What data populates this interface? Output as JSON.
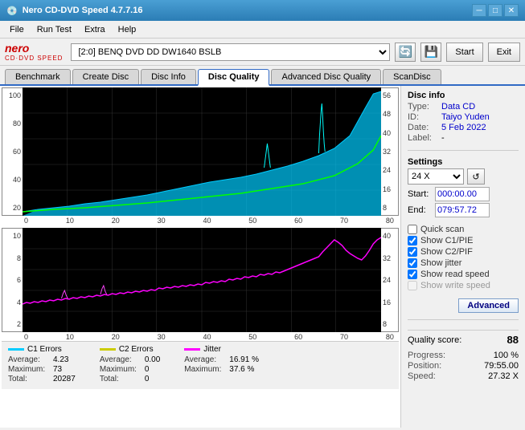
{
  "titleBar": {
    "title": "Nero CD-DVD Speed 4.7.7.16",
    "controls": [
      "minimize",
      "maximize",
      "close"
    ]
  },
  "menuBar": {
    "items": [
      "File",
      "Run Test",
      "Extra",
      "Help"
    ]
  },
  "toolbar": {
    "logoTop": "nero",
    "logoBottom": "CD·DVD SPEED",
    "driveLabel": "[2:0]  BENQ DVD DD DW1640 BSLB",
    "startLabel": "Start",
    "exitLabel": "Exit"
  },
  "tabs": [
    {
      "label": "Benchmark",
      "active": false
    },
    {
      "label": "Create Disc",
      "active": false
    },
    {
      "label": "Disc Info",
      "active": false
    },
    {
      "label": "Disc Quality",
      "active": true
    },
    {
      "label": "Advanced Disc Quality",
      "active": false
    },
    {
      "label": "ScanDisc",
      "active": false
    }
  ],
  "discInfo": {
    "sectionTitle": "Disc info",
    "typeLabel": "Type:",
    "typeValue": "Data CD",
    "idLabel": "ID:",
    "idValue": "Taiyo Yuden",
    "dateLabel": "Date:",
    "dateValue": "5 Feb 2022",
    "labelLabel": "Label:",
    "labelValue": "-"
  },
  "settings": {
    "sectionTitle": "Settings",
    "speedLabel": "24 X",
    "startLabel": "Start:",
    "startValue": "000:00.00",
    "endLabel": "End:",
    "endValue": "079:57.72"
  },
  "checkboxes": [
    {
      "label": "Quick scan",
      "checked": false,
      "enabled": true
    },
    {
      "label": "Show C1/PIE",
      "checked": true,
      "enabled": true
    },
    {
      "label": "Show C2/PIF",
      "checked": true,
      "enabled": true
    },
    {
      "label": "Show jitter",
      "checked": true,
      "enabled": true
    },
    {
      "label": "Show read speed",
      "checked": true,
      "enabled": true
    },
    {
      "label": "Show write speed",
      "checked": false,
      "enabled": false
    }
  ],
  "advancedButton": "Advanced",
  "qualityScore": {
    "label": "Quality score:",
    "value": "88"
  },
  "progress": {
    "progressLabel": "Progress:",
    "progressValue": "100 %",
    "positionLabel": "Position:",
    "positionValue": "79:55.00",
    "speedLabel": "Speed:",
    "speedValue": "27.32 X"
  },
  "legend": {
    "c1": {
      "label": "C1 Errors",
      "color": "#00ccff",
      "average": {
        "label": "Average:",
        "value": "4.23"
      },
      "maximum": {
        "label": "Maximum:",
        "value": "73"
      },
      "total": {
        "label": "Total:",
        "value": "20287"
      }
    },
    "c2": {
      "label": "C2 Errors",
      "color": "#cccc00",
      "average": {
        "label": "Average:",
        "value": "0.00"
      },
      "maximum": {
        "label": "Maximum:",
        "value": "0"
      },
      "total": {
        "label": "Total:",
        "value": "0"
      }
    },
    "jitter": {
      "label": "Jitter",
      "color": "#ff00ff",
      "average": {
        "label": "Average:",
        "value": "16.91 %"
      },
      "maximum": {
        "label": "Maximum:",
        "value": "37.6 %"
      }
    }
  },
  "topChartYAxis": [
    "56",
    "48",
    "40",
    "32",
    "24",
    "16",
    "8"
  ],
  "bottomChartYAxis": [
    "40",
    "32",
    "24",
    "16",
    "8"
  ],
  "xAxisLabels": [
    "0",
    "10",
    "20",
    "30",
    "40",
    "50",
    "60",
    "70",
    "80"
  ],
  "topChartLeftYAxis": [
    "100",
    "80",
    "60",
    "40",
    "20"
  ],
  "bottomChartLeftYAxis": [
    "10",
    "8",
    "6",
    "4",
    "2"
  ]
}
